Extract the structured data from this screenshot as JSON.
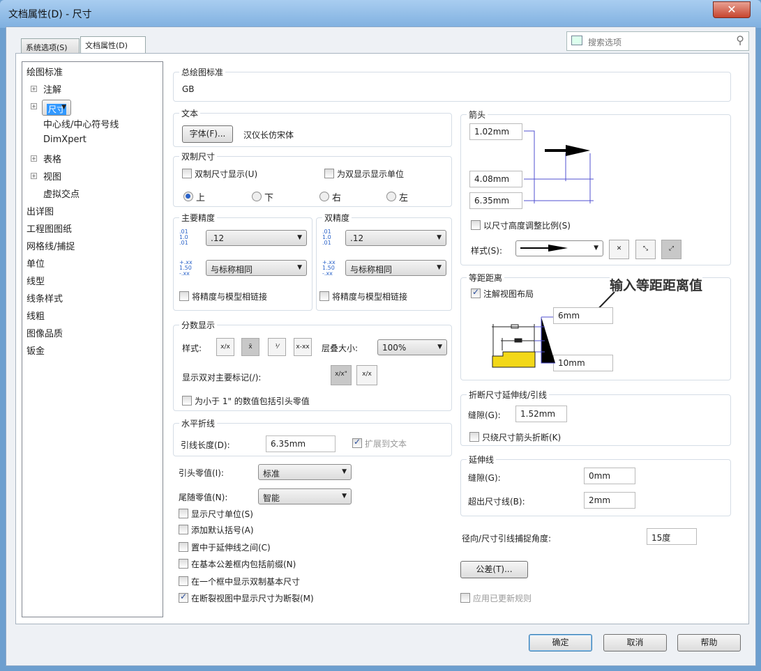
{
  "window": {
    "title": "文档属性(D) - 尺寸",
    "close": "✕"
  },
  "tabs": [
    "系统选项(S)",
    "文档属性(D)"
  ],
  "search": {
    "placeholder": "搜索选项"
  },
  "tree": [
    "绘图标准",
    "注解",
    "尺寸",
    "中心线/中心符号线",
    "DimXpert",
    "表格",
    "视图",
    "虚拟交点",
    "出详图",
    "工程图图纸",
    "网格线/捕捉",
    "单位",
    "线型",
    "线条样式",
    "线粗",
    "图像品质",
    "钣金"
  ],
  "overall": {
    "title": "总绘图标准",
    "value": "GB"
  },
  "text": {
    "title": "文本",
    "font_button": "字体(F)...",
    "font": "汉仪长仿宋体"
  },
  "dual": {
    "title": "双制尺寸",
    "show": "双制尺寸显示(U)",
    "units": "为双显示显示单位",
    "radios": [
      "上",
      "下",
      "右",
      "左"
    ],
    "selected": "上"
  },
  "primary_precision": {
    "title": "主要精度",
    "value": ".12",
    "tolerance": "与标称相同",
    "link": "将精度与模型相链接"
  },
  "dual_precision": {
    "title": "双精度",
    "value": ".12",
    "tolerance": "与标称相同",
    "link": "将精度与模型相链接"
  },
  "fraction": {
    "title": "分数显示",
    "style_label": "样式:",
    "stack_label": "层叠大小:",
    "stack_value": "100%",
    "dual_label": "显示双对主要标记(/):",
    "leading_zero": "为小于 1\" 的数值包括引头零值"
  },
  "jog": {
    "title": "水平折线",
    "length_label": "引线长度(D):",
    "length": "6.35mm",
    "extend": "扩展到文本"
  },
  "leading_zeros": {
    "label": "引头零值(I):",
    "value": "标准"
  },
  "trailing_zeros": {
    "label": "尾随零值(N):",
    "value": "智能"
  },
  "options": [
    {
      "label": "显示尺寸单位(S)",
      "checked": false
    },
    {
      "label": "添加默认括号(A)",
      "checked": false
    },
    {
      "label": "置中于延伸线之间(C)",
      "checked": false
    },
    {
      "label": "在基本公差框内包括前缀(N)",
      "checked": false
    },
    {
      "label": "在一个框中显示双制基本尺寸",
      "checked": false
    },
    {
      "label": "在断裂视图中显示尺寸为断裂(M)",
      "checked": true
    }
  ],
  "arrows": {
    "title": "箭头",
    "v1": "1.02mm",
    "v2": "4.08mm",
    "v3": "6.35mm",
    "scale": "以尺寸高度调整比例(S)",
    "style_label": "样式(S):"
  },
  "offset": {
    "title": "等距距离",
    "annotation_layout": "注解视图布局",
    "annotation": "输入等距距离值",
    "v1": "6mm",
    "v2": "10mm"
  },
  "break": {
    "title": "折断尺寸延伸线/引线",
    "gap_label": "缝隙(G):",
    "gap": "1.52mm",
    "only_arrow": "只绕尺寸箭头折断(K)"
  },
  "extension": {
    "title": "延伸线",
    "gap_label": "缝隙(G):",
    "gap": "0mm",
    "beyond_label": "超出尺寸线(B):",
    "beyond": "2mm"
  },
  "radial": {
    "label": "径向/尺寸引线捕捉角度:",
    "value": "15度"
  },
  "tolerance_button": "公差(T)...",
  "apply_rules": "应用已更新规则",
  "footer": {
    "ok": "确定",
    "cancel": "取消",
    "help": "帮助"
  }
}
